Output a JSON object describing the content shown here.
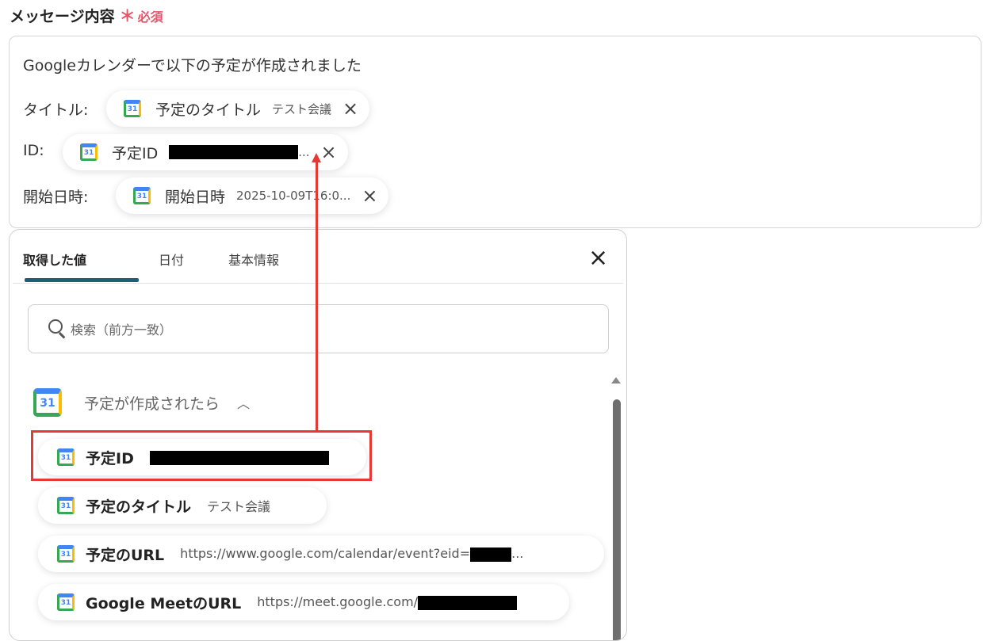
{
  "field": {
    "label": "メッセージ内容",
    "required_mark": "＊",
    "required_text": "必須"
  },
  "editor": {
    "lead": "Googleカレンダーで以下の予定が作成されました",
    "rows": [
      {
        "label": "タイトル:",
        "chip_name": "予定のタイトル",
        "chip_value": "テスト会議",
        "remove": "×"
      },
      {
        "label": "ID:",
        "chip_name": "予定ID",
        "chip_value_suffix": "...",
        "remove": "×"
      },
      {
        "label": "開始日時:",
        "chip_name": "開始日時",
        "chip_value": "2025-10-09T16:0...",
        "remove": "×"
      }
    ]
  },
  "panel": {
    "tabs": [
      "取得した値",
      "日付",
      "基本情報"
    ],
    "active_tab": "取得した値",
    "close": "×",
    "search_placeholder": "検索（前方一致）",
    "section": {
      "title": "予定が作成されたら",
      "icon_text": "31",
      "chevron": "︿"
    },
    "items": [
      {
        "name": "予定ID",
        "value": ""
      },
      {
        "name": "予定のタイトル",
        "value": "テスト会議"
      },
      {
        "name": "予定のURL",
        "value": "https://www.google.com/calendar/event?eid=",
        "value_suffix": "..."
      },
      {
        "name": "Google MeetのURL",
        "value": "https://meet.google.com/"
      }
    ]
  },
  "icons": {
    "calendar": "google-calendar-icon",
    "calendar_text": "31"
  },
  "colors": {
    "required": "#e8546a",
    "tab_underline": "#1d5f73",
    "annotation": "#e53935"
  }
}
